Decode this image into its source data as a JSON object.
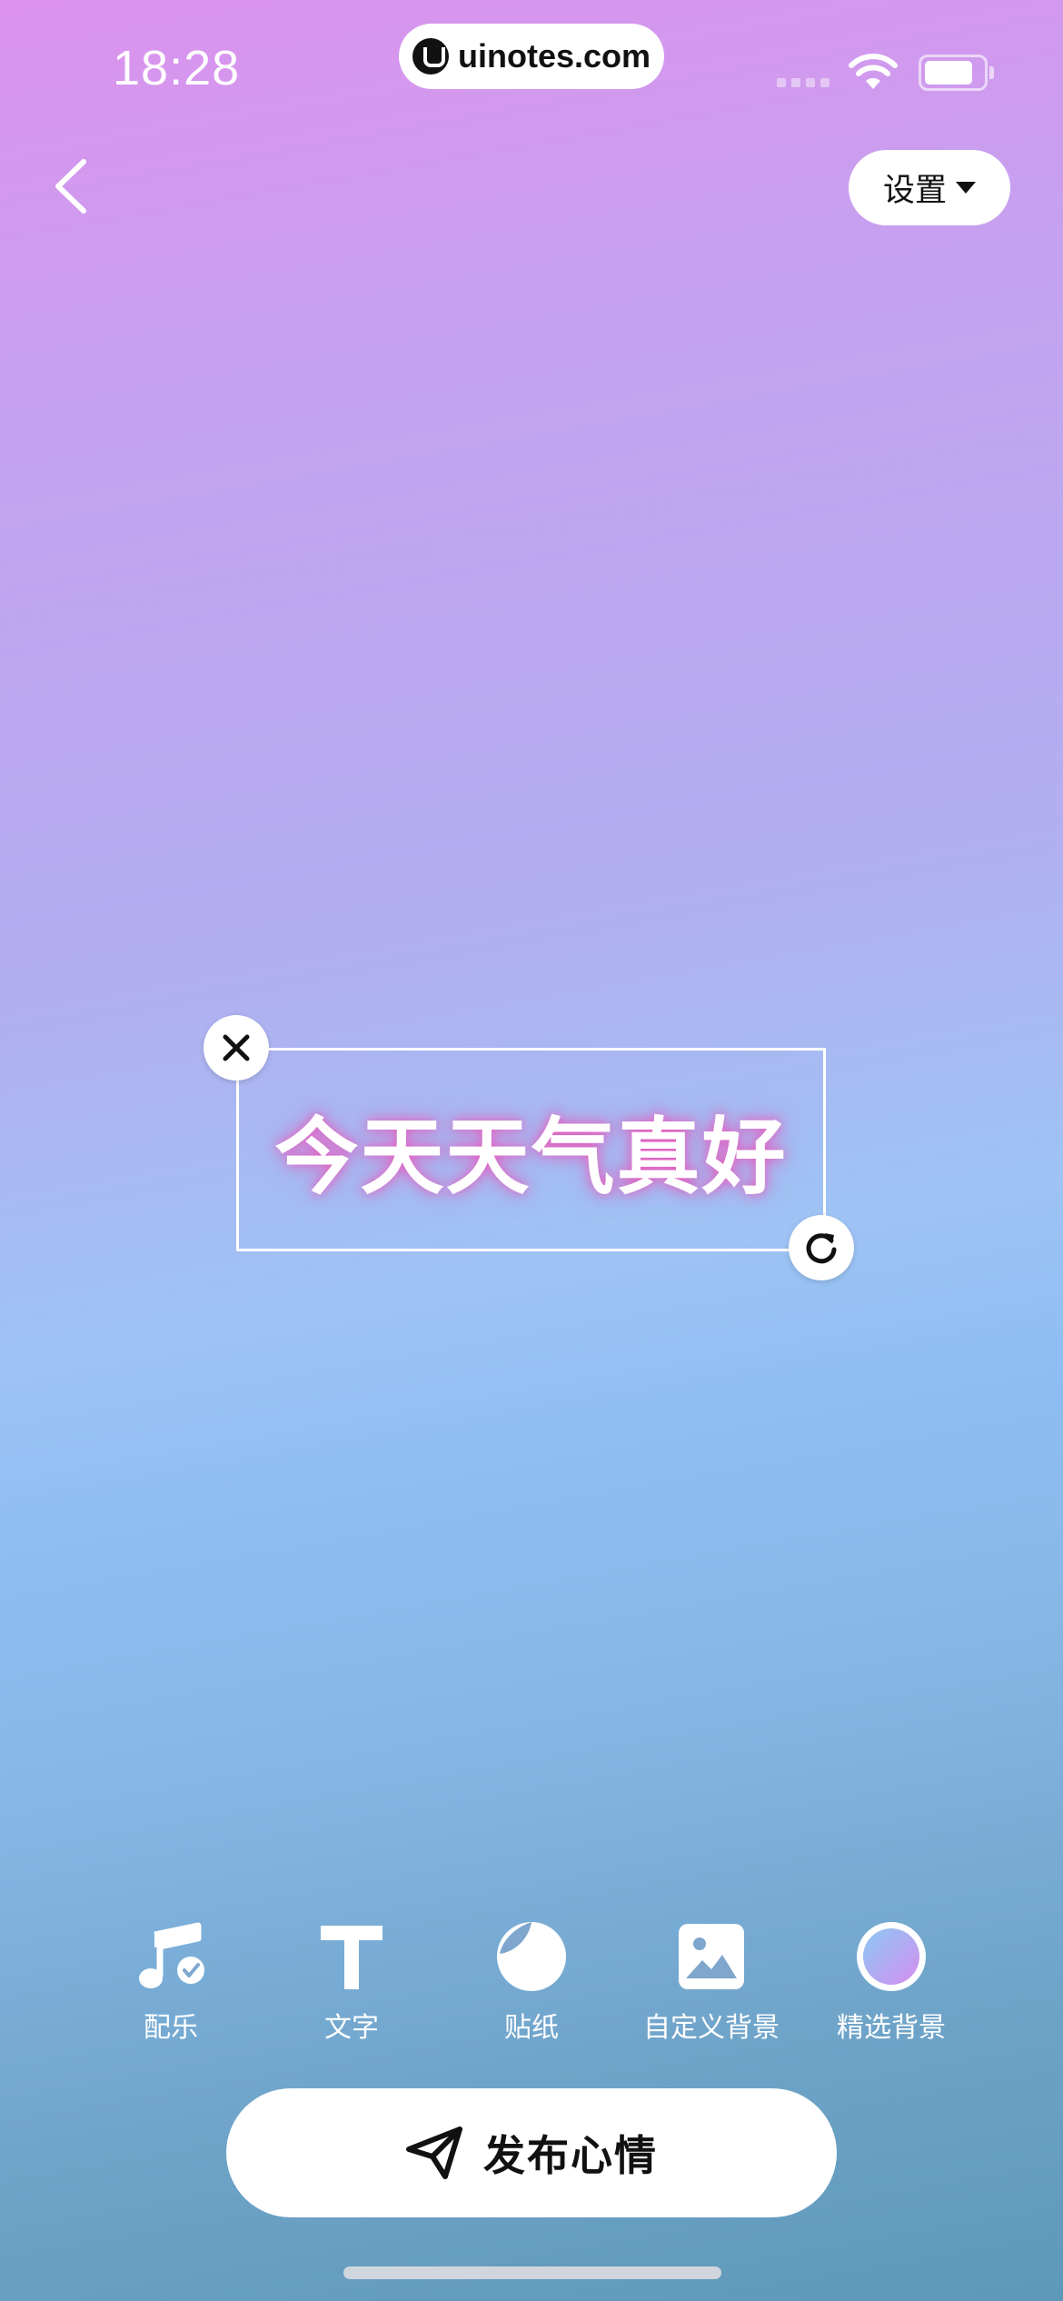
{
  "status_bar": {
    "time": "18:28",
    "watermark": "uinotes.com"
  },
  "nav": {
    "back_icon": "chevron-left-icon",
    "settings_label": "设置"
  },
  "sticker": {
    "text": "今天天气真好",
    "glow_color": "#f050b4"
  },
  "toolbar": {
    "items": [
      {
        "label": "配乐",
        "icon": "music-note-icon"
      },
      {
        "label": "文字",
        "icon": "text-t-icon"
      },
      {
        "label": "贴纸",
        "icon": "sticker-icon"
      },
      {
        "label": "自定义背景",
        "icon": "image-icon"
      },
      {
        "label": "精选背景",
        "icon": "gradient-circle-icon"
      }
    ]
  },
  "publish": {
    "label": "发布心情",
    "icon": "paper-plane-icon"
  }
}
